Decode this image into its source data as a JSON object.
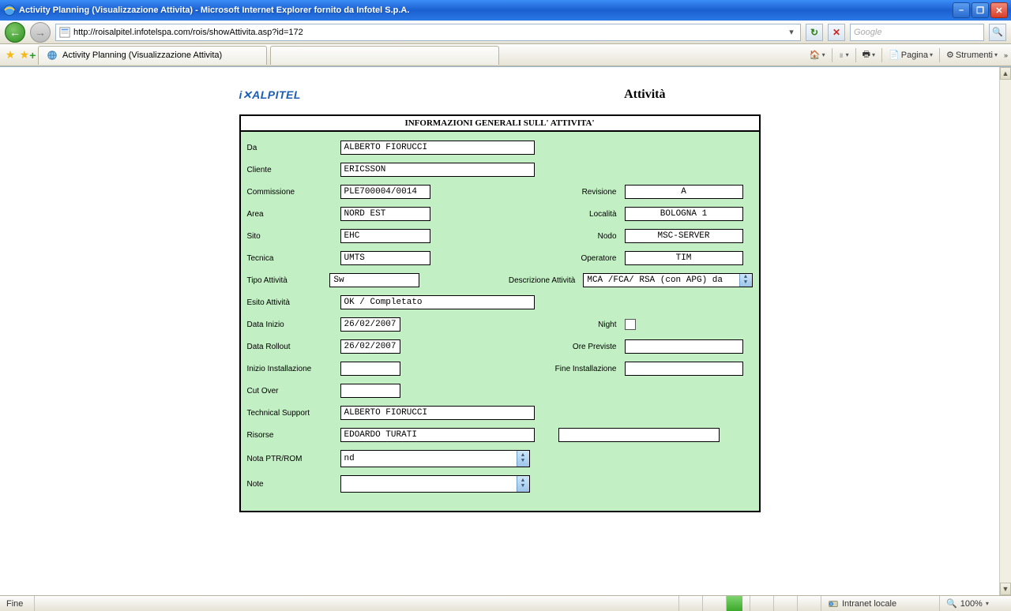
{
  "window": {
    "title": "Activity Planning (Visualizzazione Attivita) - Microsoft Internet Explorer fornito da Infotel S.p.A."
  },
  "addressbar": {
    "url": "http://roisalpitel.infotelspa.com/rois/showAttivita.asp?id=172"
  },
  "searchbox": {
    "placeholder": "Google"
  },
  "toolbar": {
    "page_label": "Pagina",
    "tools_label": "Strumenti"
  },
  "tab": {
    "label": "Activity Planning (Visualizzazione Attivita)"
  },
  "page": {
    "logo": "i✕ALPITEL",
    "title": "Attività",
    "panel_title": "INFORMAZIONI GENERALI SULL' ATTIVITA'"
  },
  "form": {
    "da_label": "Da",
    "da": "ALBERTO FIORUCCI",
    "cliente_label": "Cliente",
    "cliente": "ERICSSON",
    "commissione_label": "Commissione",
    "commissione": "PLE700004/0014",
    "revisione_label": "Revisione",
    "revisione": "A",
    "area_label": "Area",
    "area": "NORD EST",
    "localita_label": "Località",
    "localita": "BOLOGNA 1",
    "sito_label": "Sito",
    "sito": "EHC",
    "nodo_label": "Nodo",
    "nodo": "MSC-SERVER",
    "tecnica_label": "Tecnica",
    "tecnica": "UMTS",
    "operatore_label": "Operatore",
    "operatore": "TIM",
    "tipo_label": "Tipo Attività",
    "tipo": "Sw",
    "descr_label": "Descrizione Attività",
    "descr": "MCA /FCA/ RSA (con APG) da",
    "esito_label": "Esito Attività",
    "esito": "OK / Completato",
    "data_inizio_label": "Data Inizio",
    "data_inizio": "26/02/2007",
    "night_label": "Night",
    "data_rollout_label": "Data Rollout",
    "data_rollout": "26/02/2007",
    "ore_prev_label": "Ore Previste",
    "ore_prev": "",
    "inizio_inst_label": "Inizio Installazione",
    "inizio_inst": "",
    "fine_inst_label": "Fine Installazione",
    "fine_inst": "",
    "cutover_label": "Cut Over",
    "cutover": "",
    "tsupport_label": "Technical Support",
    "tsupport": "ALBERTO FIORUCCI",
    "risorse_label": "Risorse",
    "risorse": "EDOARDO TURATI",
    "risorse2": "",
    "nota_ptr_label": "Nota PTR/ROM",
    "nota_ptr": "nd",
    "note_label": "Note",
    "note": ""
  },
  "statusbar": {
    "done": "Fine",
    "zone": "Intranet locale",
    "zoom": "100%"
  }
}
